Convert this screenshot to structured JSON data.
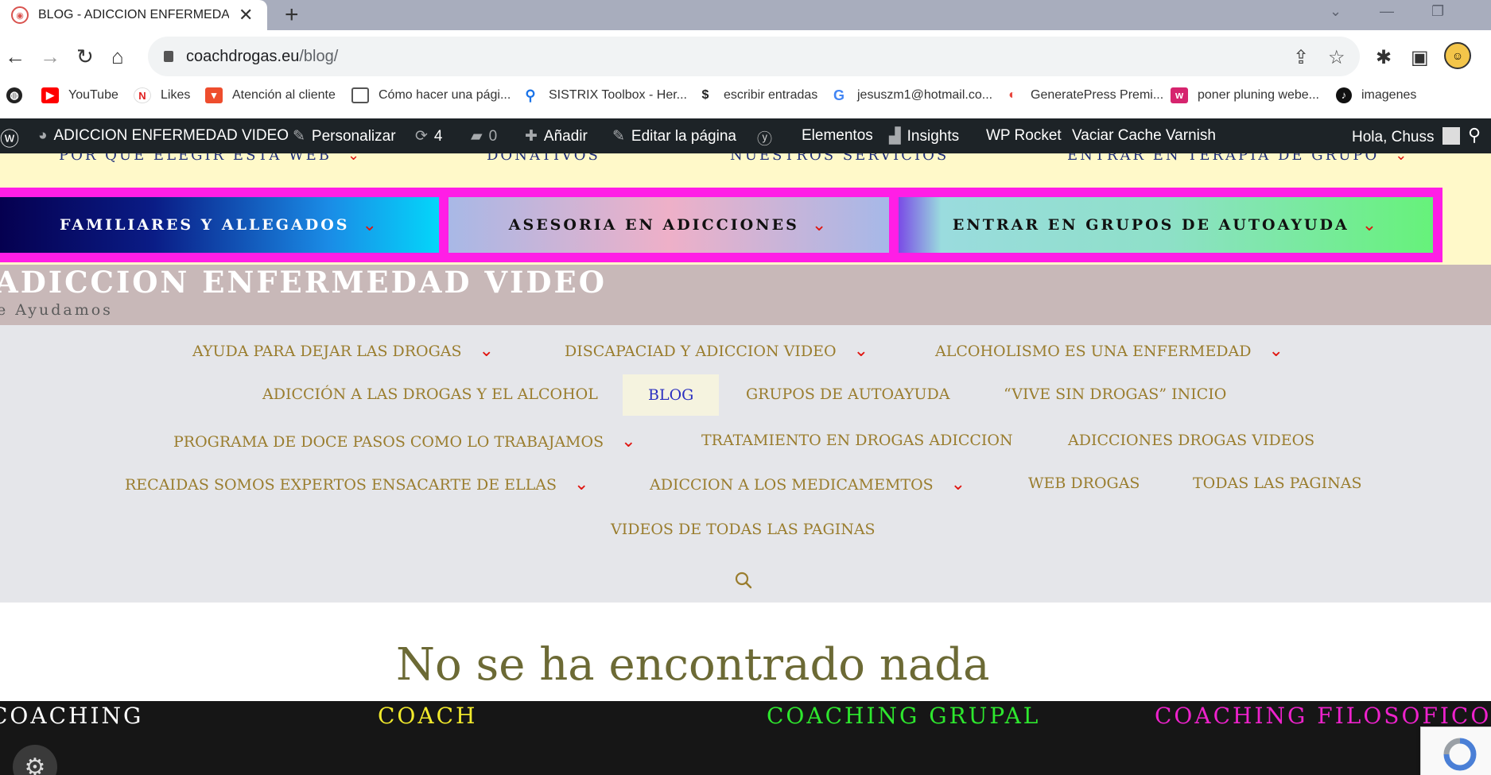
{
  "browser": {
    "tab_title": "BLOG - ADICCION ENFERMEDAD V",
    "url_domain": "coachdrogas.eu",
    "url_path": "/blog/"
  },
  "bookmarks": [
    {
      "label": "YouTube",
      "icon": "youtube-icon",
      "color": "#ff0000"
    },
    {
      "label": "Likes",
      "icon": "n-icon",
      "color": "#e02020"
    },
    {
      "label": "Atención al cliente",
      "icon": "shop-icon",
      "color": "#ee4d2d"
    },
    {
      "label": "Cómo hacer una pági...",
      "icon": "page-icon",
      "color": "#555555"
    },
    {
      "label": "SISTRIX Toolbox - Her...",
      "icon": "search-icon",
      "color": "#1a73e8"
    },
    {
      "label": "escribir entradas",
      "icon": "dollar-icon",
      "color": "#222222"
    },
    {
      "label": "jesuszm1@hotmail.co...",
      "icon": "google-icon",
      "color": "#4285f4"
    },
    {
      "label": "GeneratePress Premi...",
      "icon": "generatepress-icon",
      "color": "#e8453c"
    },
    {
      "label": "poner pluning webe...",
      "icon": "w-icon",
      "color": "#d6246e"
    },
    {
      "label": "imagenes",
      "icon": "tiktok-icon",
      "color": "#111111"
    }
  ],
  "adminbar": {
    "site": "ADICCION ENFERMEDAD VIDEO",
    "customize": "Personalizar",
    "updates": "4",
    "comments": "0",
    "add": "Añadir",
    "edit": "Editar la página",
    "elements": "Elementos",
    "insights": "Insights",
    "rocket": "WP Rocket",
    "varnish": "Vaciar Cache Varnish",
    "greeting": "Hola, Chuss"
  },
  "topmenu": [
    "POR QUE ELEGIR ESTA WEB",
    "DONATIVOS",
    "NUESTROS SERVICIOS",
    "ENTRAR EN TERAPIA DE GRUPO"
  ],
  "buttons": [
    "FAMILIARES Y ALLEGADOS",
    "ASESORIA EN ADICCIONES",
    "ENTRAR EN GRUPOS DE AUTOAYUDA"
  ],
  "site": {
    "title": "ADICCION ENFERMEDAD VIDEO",
    "tagline": "e Ayudamos"
  },
  "nav": [
    "AYUDA PARA DEJAR LAS DROGAS",
    "DISCAPACIAD Y ADICCION VIDEO",
    "ALCOHOLISMO ES UNA ENFERMEDAD",
    "ADICCIÓN A LAS DROGAS Y EL ALCOHOL",
    "BLOG",
    "GRUPOS DE AUTOAYUDA",
    "“VIVE SIN DROGAS” INICIO",
    "PROGRAMA DE DOCE PASOS COMO LO TRABAJAMOS",
    "TRATAMIENTO EN DROGAS ADICCION",
    "ADICCIONES DROGAS VIDEOS",
    "RECAIDAS SOMOS EXPERTOS ENSACARTE DE ELLAS",
    "ADICCION A LOS MEDICAMEMTOS",
    "WEB DROGAS",
    "TODAS LAS PAGINAS",
    "VIDEOS DE TODAS LAS PAGINAS"
  ],
  "content": {
    "heading": "No se ha encontrado nada"
  },
  "footer": [
    {
      "label": "COACHING",
      "color": "#ffffff"
    },
    {
      "label": "COACH",
      "color": "#f2ea2c"
    },
    {
      "label": "COACHING GRUPAL",
      "color": "#2ee82e"
    },
    {
      "label": "COACHING FILOSOFICO",
      "color": "#ee22cc"
    }
  ]
}
